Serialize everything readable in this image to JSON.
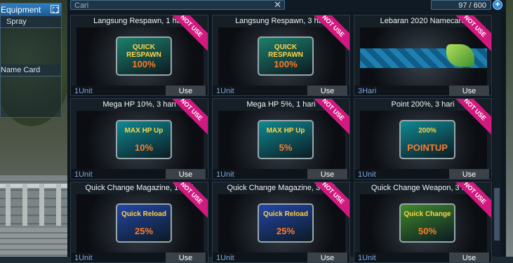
{
  "equipment": {
    "title": "Equipment",
    "rows": [
      "Spray",
      "Name Card"
    ]
  },
  "search": {
    "placeholder": "Cari",
    "clear_icon": "close-icon"
  },
  "counter": {
    "value": "97 / 600",
    "button_icon": "plus-circle-icon"
  },
  "cards": [
    {
      "title": "Langsung Respawn, 1 hari",
      "unit": "1Unit",
      "use": "Use",
      "badge": "NOT USE",
      "art_line1": "QUICK RESPAWN",
      "art_line2": "100%",
      "art_color": "#1d7f6b"
    },
    {
      "title": "Langsung Respawn, 3 hari",
      "unit": "1Unit",
      "use": "Use",
      "badge": "NOT USE",
      "art_line1": "QUICK RESPAWN",
      "art_line2": "100%",
      "art_color": "#1d7f6b"
    },
    {
      "title": "Lebaran 2020 Namecard",
      "unit": "3Hari",
      "use": "Use",
      "badge": "NOT USE",
      "art_line1": "",
      "art_line2": "",
      "art_color": "#1f7fb0"
    },
    {
      "title": "Mega HP 10%, 3 hari",
      "unit": "1Unit",
      "use": "Use",
      "badge": "NOT USE",
      "art_line1": "MAX HP Up",
      "art_line2": "10%",
      "art_color": "#0f8a93"
    },
    {
      "title": "Mega HP 5%, 1 hari",
      "unit": "1Unit",
      "use": "Use",
      "badge": "NOT USE",
      "art_line1": "MAX HP Up",
      "art_line2": "5%",
      "art_color": "#0f8a93"
    },
    {
      "title": "Point 200%, 3 hari",
      "unit": "1Unit",
      "use": "Use",
      "badge": "NOT USE",
      "art_line1": "200%",
      "art_line2": "POINTUP",
      "art_color": "#0f8a93"
    },
    {
      "title": "Quick Change Magazine, 1 hari",
      "unit": "1Unit",
      "use": "Use",
      "badge": "NOT USE",
      "art_line1": "Quick Reload",
      "art_line2": "25%",
      "art_color": "#2446a8"
    },
    {
      "title": "Quick Change Magazine, 3 hari",
      "unit": "1Unit",
      "use": "Use",
      "badge": "NOT USE",
      "art_line1": "Quick Reload",
      "art_line2": "25%",
      "art_color": "#2446a8"
    },
    {
      "title": "Quick Change Weapon, 3 hari",
      "unit": "1Unit",
      "use": "Use",
      "badge": "NOT USE",
      "art_line1": "Quick Change",
      "art_line2": "50%",
      "art_color": "#3f8a2a"
    }
  ]
}
